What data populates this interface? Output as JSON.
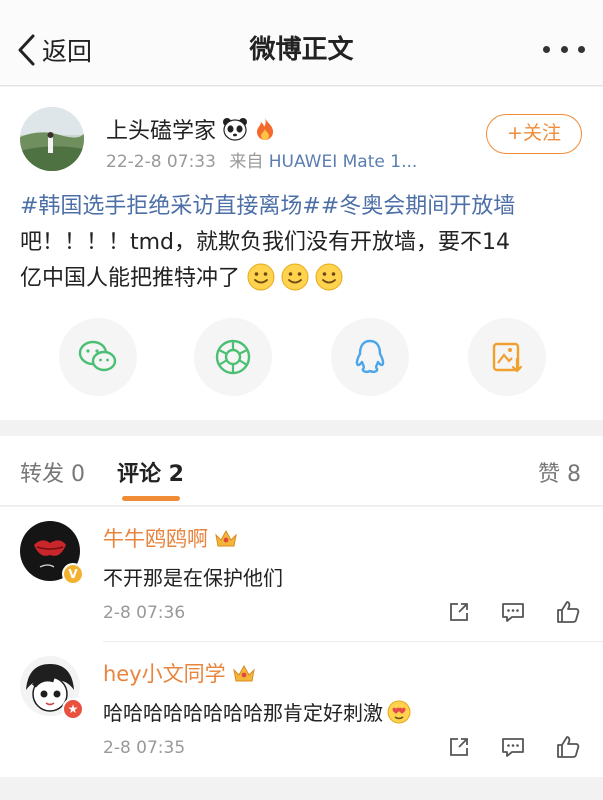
{
  "nav": {
    "back_label": "返回",
    "title": "微博正文"
  },
  "post": {
    "author": "上头磕学家",
    "timestamp": "22-2-8 07:33",
    "source_prefix": "来自",
    "source": "HUAWEI Mate 1...",
    "follow_label": "+关注",
    "hashtag1": "#韩国选手拒绝采访直接离场#",
    "hashtag2": "#冬奥会期间开放墙",
    "text_line2": "吧！！！！tmd，就欺负我们没有开放墙，要不14",
    "text_line3": "亿中国人能把推特冲了"
  },
  "share": [
    {
      "name": "wechat-icon"
    },
    {
      "name": "moments-icon"
    },
    {
      "name": "qq-icon"
    },
    {
      "name": "save-image-icon"
    }
  ],
  "tabs": {
    "repost": "转发 0",
    "comments": "评论 2",
    "likes": "赞 8"
  },
  "comments": [
    {
      "author": "牛牛鸥鸥啊",
      "text": "不开那是在保护他们",
      "time": "2-8 07:36"
    },
    {
      "author": "hey小文同学",
      "text": "哈哈哈哈哈哈哈哈那肯定好刺激",
      "time": "2-8 07:35"
    }
  ],
  "colors": {
    "accent": "#f08c38",
    "link": "#4d6fa7",
    "source": "#5b7db1"
  }
}
